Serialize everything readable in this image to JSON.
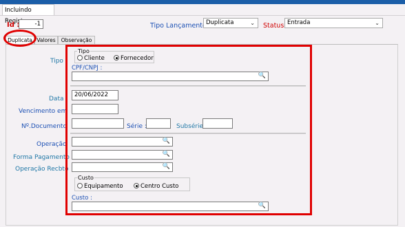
{
  "window": {
    "tab_title": "Incluindo Registro"
  },
  "header": {
    "id_label": "Id :",
    "id_value": "-1",
    "tipo_lancamento_label": "Tipo Lançamento :",
    "tipo_lancamento_value": "Duplicata",
    "status_label": "Status :",
    "status_value": "Entrada"
  },
  "tabs": [
    {
      "label": "Duplicata",
      "active": true
    },
    {
      "label": "Valores",
      "active": false
    },
    {
      "label": "Observação",
      "active": false
    }
  ],
  "form": {
    "tipo_label": "Tipo",
    "tipo_group_title": "Tipo",
    "tipo_options": [
      "Cliente",
      "Fornecedor"
    ],
    "tipo_selected": "Fornecedor",
    "cpf_label": "CPF/CNPJ :",
    "cpf_value": "",
    "data_label": "Data",
    "data_value": "20/06/2022",
    "vencimento_label": "Vencimento em",
    "vencimento_value": "",
    "documento_label": "Nº.Documento",
    "documento_value": "",
    "serie_label": "Série :",
    "serie_value": "",
    "subserie_label": "Subsérie :",
    "subserie_value": "",
    "operacao_label": "Operação",
    "operacao_value": "",
    "forma_pagamento_label": "Forma Pagamento",
    "forma_pagamento_value": "",
    "operacao_recbto_label": "Operação Recbto",
    "operacao_recbto_value": "",
    "custo_group_title": "Custo",
    "custo_options": [
      "Equipamento",
      "Centro Custo"
    ],
    "custo_selected": "Centro Custo",
    "custo_label": "Custo :",
    "custo_value": ""
  },
  "colors": {
    "accent_bar": "#1b5ea8",
    "highlight_red": "#e00000",
    "label_teal": "#1f77a6",
    "label_blue": "#1a4fb3"
  },
  "icons": {
    "search": "search-icon",
    "dropdown": "chevron-down-icon"
  }
}
